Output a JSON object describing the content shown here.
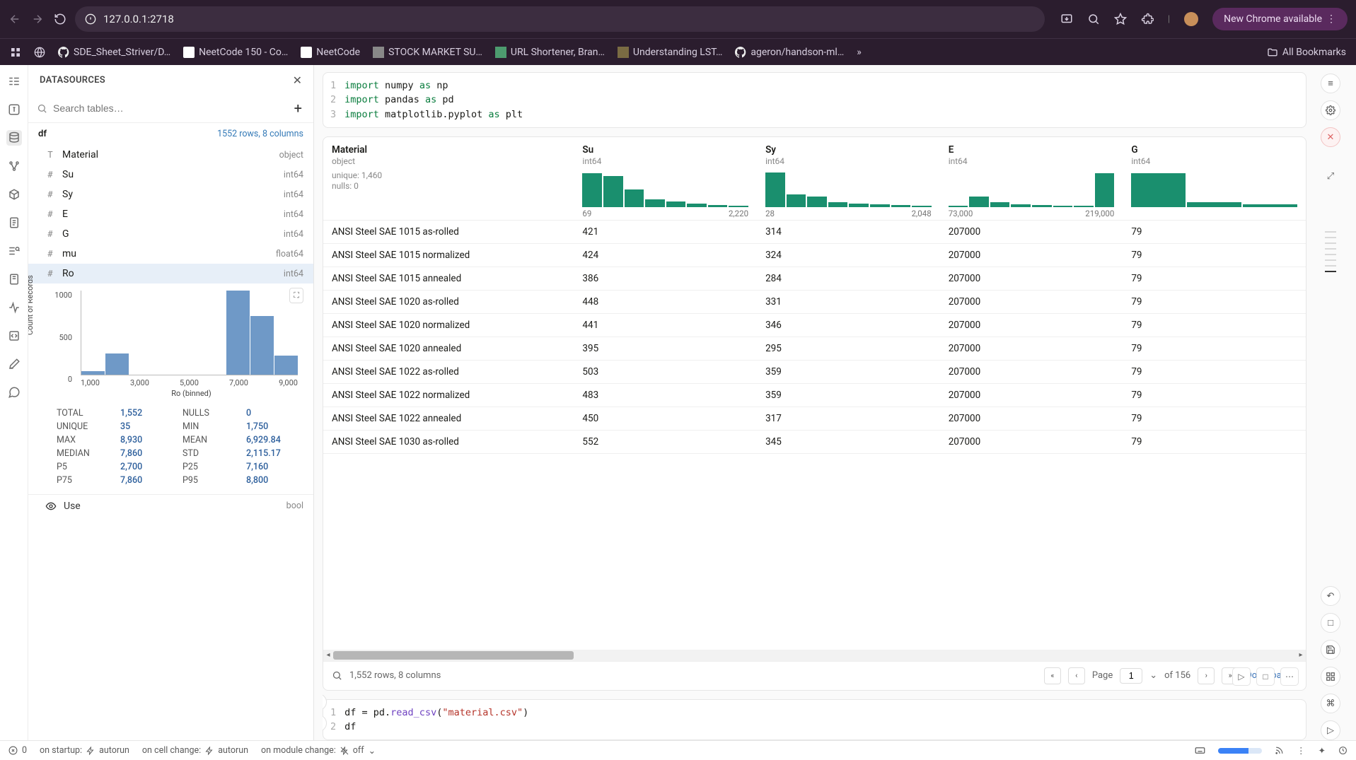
{
  "browser": {
    "url": "127.0.0.1:2718",
    "new_chrome_label": "New Chrome available"
  },
  "bookmarks": {
    "items": [
      "SDE_Sheet_Striver/D…",
      "NeetCode 150 - Co…",
      "NeetCode",
      "STOCK MARKET SU…",
      "URL Shortener, Bran…",
      "Understanding LST…",
      "ageron/handson-ml…"
    ],
    "all_bookmarks": "All Bookmarks"
  },
  "ds": {
    "title": "DATASOURCES",
    "search_placeholder": "Search tables…",
    "table_name": "df",
    "table_meta": "1552 rows, 8 columns",
    "columns": [
      {
        "glyph": "T",
        "name": "Material",
        "type": "object"
      },
      {
        "glyph": "#",
        "name": "Su",
        "type": "int64"
      },
      {
        "glyph": "#",
        "name": "Sy",
        "type": "int64"
      },
      {
        "glyph": "#",
        "name": "E",
        "type": "int64"
      },
      {
        "glyph": "#",
        "name": "G",
        "type": "int64"
      },
      {
        "glyph": "#",
        "name": "mu",
        "type": "float64"
      },
      {
        "glyph": "#",
        "name": "Ro",
        "type": "int64"
      }
    ],
    "selected_index": 6,
    "use_row": {
      "label": "Use",
      "type": "bool"
    }
  },
  "chart_data": {
    "type": "bar",
    "title": "",
    "xlabel": "Ro (binned)",
    "ylabel": "Count of Records",
    "ylim": [
      0,
      1000
    ],
    "yticks": [
      1000,
      500,
      0
    ],
    "xticks": [
      "1,000",
      "3,000",
      "5,000",
      "7,000",
      "9,000"
    ],
    "categories": [
      "1000",
      "2000",
      "3000",
      "4000",
      "5000",
      "6000",
      "7000",
      "8000",
      "9000"
    ],
    "values": [
      40,
      250,
      0,
      0,
      0,
      0,
      1000,
      700,
      230
    ]
  },
  "stats": {
    "TOTAL": "1,552",
    "NULLS": "0",
    "UNIQUE": "35",
    "MIN": "1,750",
    "MAX": "8,930",
    "MEAN": "6,929.84",
    "MEDIAN": "7,860",
    "STD": "2,115.17",
    "P5": "2,700",
    "P25": "7,160",
    "P75": "7,860",
    "P95": "8,800"
  },
  "code_cell_1": {
    "lines": [
      "import numpy as np",
      "import pandas as pd",
      "import matplotlib.pyplot as plt"
    ]
  },
  "code_cell_2": {
    "lines": [
      "df = pd.read_csv(\"material.csv\")",
      "df"
    ]
  },
  "data_table": {
    "columns": [
      {
        "name": "Material",
        "type": "object",
        "summary": "unique: 1,460\nnulls: 0",
        "range_min": "",
        "range_max": ""
      },
      {
        "name": "Su",
        "type": "int64",
        "range_min": "69",
        "range_max": "2,220",
        "hist": [
          96,
          88,
          50,
          22,
          16,
          10,
          6,
          4
        ]
      },
      {
        "name": "Sy",
        "type": "int64",
        "range_min": "28",
        "range_max": "2,048",
        "hist": [
          98,
          36,
          30,
          14,
          10,
          8,
          5,
          3
        ]
      },
      {
        "name": "E",
        "type": "int64",
        "range_min": "73,000",
        "range_max": "219,000",
        "hist": [
          4,
          30,
          14,
          8,
          6,
          4,
          3,
          96
        ]
      },
      {
        "name": "G",
        "type": "int64",
        "range_min": "",
        "range_max": "",
        "hist": [
          96,
          14,
          8
        ]
      }
    ],
    "rows": [
      [
        "ANSI Steel SAE 1015 as-rolled",
        "421",
        "314",
        "207000",
        "79"
      ],
      [
        "ANSI Steel SAE 1015 normalized",
        "424",
        "324",
        "207000",
        "79"
      ],
      [
        "ANSI Steel SAE 1015 annealed",
        "386",
        "284",
        "207000",
        "79"
      ],
      [
        "ANSI Steel SAE 1020 as-rolled",
        "448",
        "331",
        "207000",
        "79"
      ],
      [
        "ANSI Steel SAE 1020 normalized",
        "441",
        "346",
        "207000",
        "79"
      ],
      [
        "ANSI Steel SAE 1020 annealed",
        "395",
        "295",
        "207000",
        "79"
      ],
      [
        "ANSI Steel SAE 1022 as-rolled",
        "503",
        "359",
        "207000",
        "79"
      ],
      [
        "ANSI Steel SAE 1022 normalized",
        "483",
        "359",
        "207000",
        "79"
      ],
      [
        "ANSI Steel SAE 1022 annealed",
        "450",
        "317",
        "207000",
        "79"
      ],
      [
        "ANSI Steel SAE 1030 as-rolled",
        "552",
        "345",
        "207000",
        "79"
      ]
    ],
    "footer": {
      "summary": "1,552 rows, 8 columns",
      "page_label": "Page",
      "page_value": "1",
      "of_label": "of 156",
      "download": "Download"
    }
  },
  "status": {
    "err_count": "0",
    "startup": "on startup:",
    "startup_mode": "autorun",
    "cell_change": "on cell change:",
    "cell_mode": "autorun",
    "module_change": "on module change:",
    "module_mode": "off"
  }
}
